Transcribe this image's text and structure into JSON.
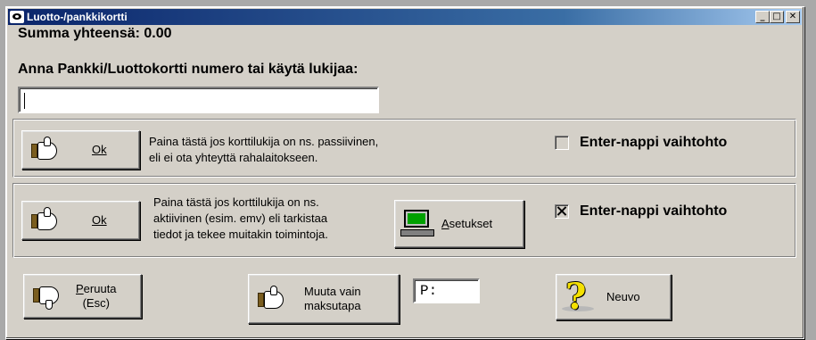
{
  "window": {
    "title": "Luotto-/pankkikortti",
    "controls": {
      "minimize": "_",
      "maximize": "□",
      "close": "✕"
    }
  },
  "summary": {
    "label": "Summa yhteensä: 0.00"
  },
  "prompt": {
    "label": "Anna Pankki/Luottokortti numero tai käytä lukijaa:"
  },
  "card_input": {
    "value": ""
  },
  "passive": {
    "ok_label": "Ok",
    "desc_lines": [
      "Paina tästä jos korttilukija on ns. passiivinen,",
      "eli ei ota yhteyttä rahalaitokseen."
    ],
    "enter_checkbox": {
      "label": "Enter-nappi vaihtohto",
      "checked": false
    }
  },
  "active": {
    "ok_label": "Ok",
    "desc_lines": [
      "Paina tästä jos korttilukija on ns.",
      "aktiivinen (esim. emv) eli tarkistaa",
      "tiedot ja tekee muitakin toimintoja."
    ],
    "settings_label": "Asetukset",
    "enter_checkbox": {
      "label": "Enter-nappi vaihtohto",
      "checked": true
    }
  },
  "bottom": {
    "cancel_line1": "Peruuta",
    "cancel_line2": "(Esc)",
    "change_line1": "Muuta vain",
    "change_line2": "maksutapa",
    "payment_field_value": "P:",
    "help_label": "Neuvo"
  }
}
